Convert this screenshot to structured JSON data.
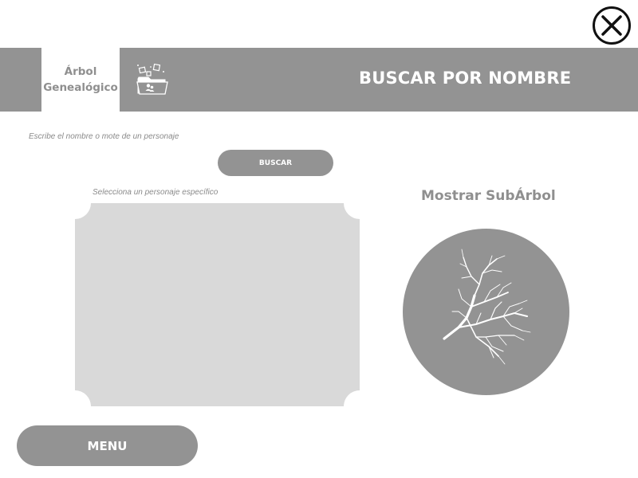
{
  "colors": {
    "primary_gray": "#939393",
    "panel_gray": "#d9d9d9",
    "text_gray": "#8f8f8f",
    "white": "#ffffff",
    "icon_black": "#111111"
  },
  "window": {
    "close_icon": "close-circle-icon"
  },
  "header": {
    "active_tab": {
      "line1": "Árbol",
      "line2": "Genealógico"
    },
    "folder_icon": "folder-upload-icon",
    "title": "BUSCAR POR NOMBRE"
  },
  "search": {
    "hint": "Escribe el nombre o mote de un personaje",
    "button_label": "BUSCAR"
  },
  "character_list": {
    "hint": "Selecciona un personaje específico",
    "items": []
  },
  "subtree": {
    "title": "Mostrar SubÁrbol",
    "icon": "tree-branches-icon"
  },
  "footer": {
    "menu_label": "MENU"
  }
}
